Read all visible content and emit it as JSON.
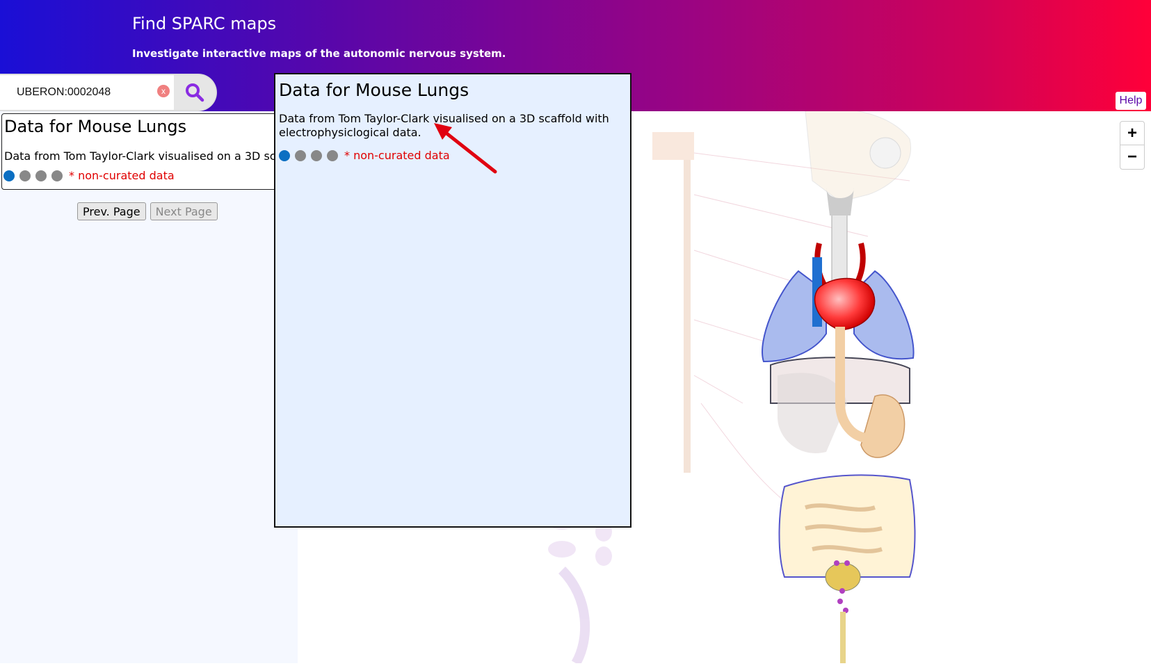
{
  "header": {
    "title": "Find SPARC maps",
    "subtitle": "Investigate interactive maps of the autonomic nervous system.",
    "help_label": "Help"
  },
  "search": {
    "value": "UBERON:0002048",
    "clear_label": "x"
  },
  "results": {
    "card": {
      "title": "Data for Mouse Lungs",
      "description": "Data from Tom Taylor-Clark visualised on a 3D scaffold with electrophysiclogical data.",
      "dot_states": [
        "active",
        "inactive",
        "inactive",
        "inactive"
      ],
      "noncurated_label": "* non-curated data"
    },
    "prev_label": "Prev. Page",
    "next_label": "Next Page"
  },
  "popup": {
    "title": "Data for Mouse Lungs",
    "description": "Data from Tom Taylor-Clark visualised on a 3D scaffold with electrophysiclogical data.",
    "noncurated_label": "* non-curated data"
  },
  "zoom": {
    "in_label": "+",
    "out_label": "−"
  },
  "colors": {
    "header_gradient_start": "#1a0fd6",
    "header_gradient_end": "#ff0039",
    "noncurated": "#e00000",
    "active_dot": "#0b6fc2",
    "popup_bg": "#e6f0ff"
  }
}
